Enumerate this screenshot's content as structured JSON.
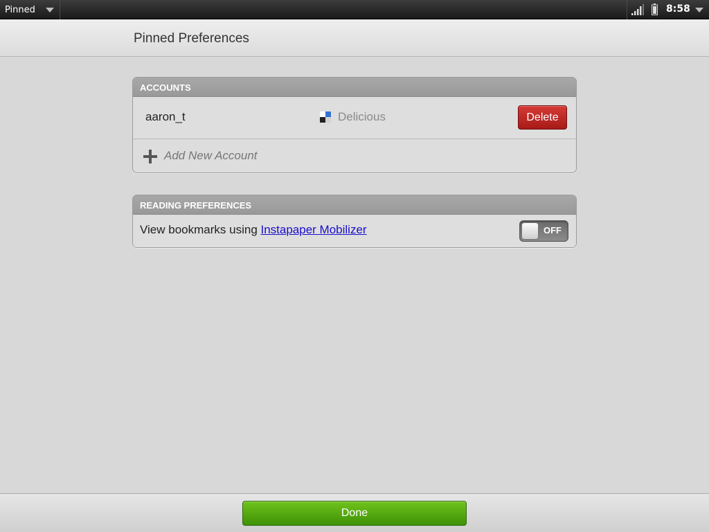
{
  "statusbar": {
    "app_menu_label": "Pinned",
    "clock": "8:58",
    "icons": [
      "chevron-down-icon",
      "signal-icon",
      "battery-icon",
      "chevron-down-icon"
    ]
  },
  "header": {
    "title": "Pinned Preferences"
  },
  "accounts": {
    "section_title": "ACCOUNTS",
    "items": [
      {
        "username": "aaron_t",
        "service": "Delicious",
        "service_icon": "delicious-icon",
        "delete_label": "Delete"
      }
    ],
    "add_label": "Add New Account"
  },
  "reading": {
    "section_title": "READING PREFERENCES",
    "pref_text": "View bookmarks using ",
    "pref_link": "Instapaper Mobilizer",
    "toggle_state": "OFF"
  },
  "footer": {
    "done_label": "Done"
  },
  "colors": {
    "delete_button": "#c02a26",
    "done_button": "#5aab12",
    "link": "#1a0dcc"
  }
}
